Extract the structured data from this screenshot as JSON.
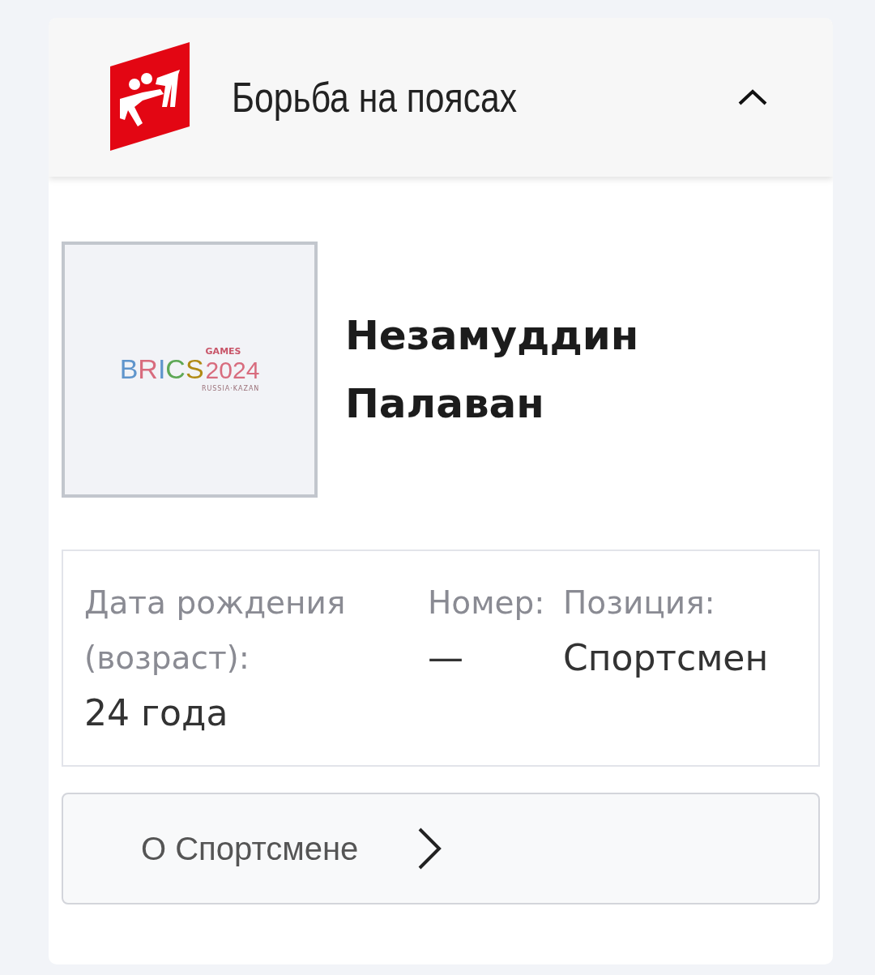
{
  "header": {
    "title": "Борьба на поясах",
    "expanded": true
  },
  "athlete": {
    "name": "Незамуддин Палаван",
    "photo": {
      "kind": "logo",
      "letters": [
        {
          "text": "B",
          "color": "#5f95cc"
        },
        {
          "text": "R",
          "color": "#d86c7e"
        },
        {
          "text": "I",
          "color": "#5f95cc"
        },
        {
          "text": "C",
          "color": "#5ea856"
        },
        {
          "text": "S",
          "color": "#b08a14"
        }
      ],
      "badge": "GAMES",
      "year": "2024",
      "caption": "RUSSIA·KAZAN"
    }
  },
  "info": [
    {
      "label": "Дата рождения (возраст):",
      "value": "24 года"
    },
    {
      "label": "Номер:",
      "value": "—"
    },
    {
      "label": "Позиция:",
      "value": "Спортсмен"
    }
  ],
  "more_button": {
    "label": "О Спортсмене"
  }
}
